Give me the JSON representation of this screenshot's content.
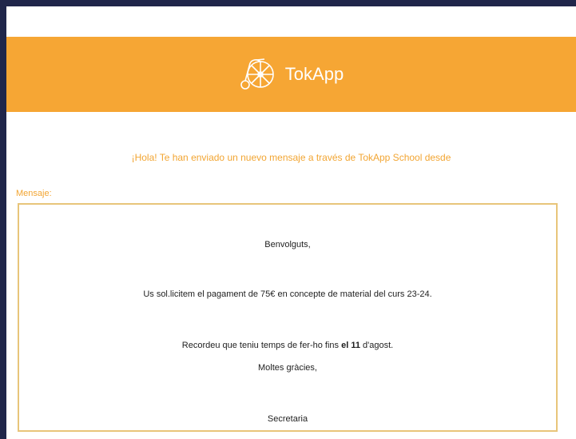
{
  "colors": {
    "brand_orange": "#f6a634",
    "text_orange": "#f2a532",
    "border_gold": "#e8c57a",
    "frame_navy": "#20264a"
  },
  "header": {
    "brand_name": "TokApp",
    "logo_icon": "penny-farthing-bicycle"
  },
  "email": {
    "intro_text": "¡Hola! Te han enviado un nuevo mensaje a través de TokApp School desde",
    "message_label": "Mensaje:",
    "message": {
      "greeting": "Benvolguts,",
      "payment_line": "Us sol.licitem el pagament de 75€ en concepte de material del curs 23-24.",
      "deadline_prefix": "Recordeu que teniu temps de fer-ho fins ",
      "deadline_bold": "el 11",
      "deadline_suffix": " d'agost.",
      "thanks": "Moltes gràcies,",
      "signature": "Secretaria"
    }
  }
}
